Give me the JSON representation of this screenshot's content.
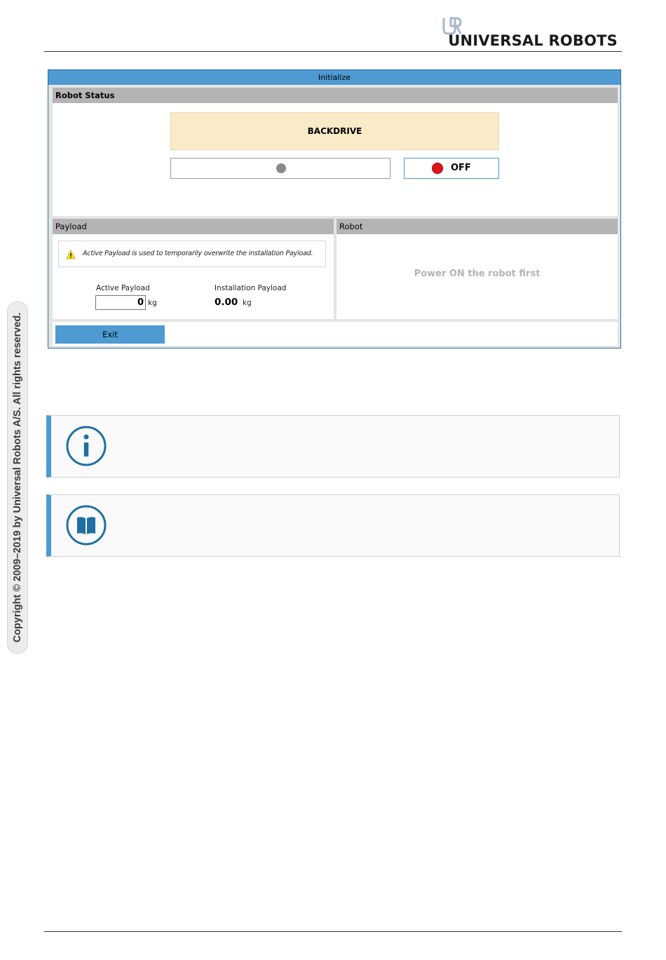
{
  "header": {
    "brand": "UNIVERSAL ROBOTS"
  },
  "sidebar": {
    "copyright": "Copyright © 2009–2019 by Universal Robots A/S. All rights reserved."
  },
  "dialog": {
    "title": "Initialize",
    "robot_status": {
      "header": "Robot Status",
      "state": "BACKDRIVE",
      "power_button_label": "OFF"
    },
    "payload": {
      "header": "Payload",
      "warning": "Active Payload is used to temporarily overwrite the installation Payload.",
      "active_label": "Active Payload",
      "active_value": "0",
      "active_unit": "kg",
      "installation_label": "Installation Payload",
      "installation_value": "0.00",
      "installation_unit": "kg"
    },
    "robot": {
      "header": "Robot",
      "message": "Power ON the robot first"
    },
    "exit_label": "Exit"
  },
  "notes": [
    {
      "icon": "info-icon"
    },
    {
      "icon": "book-icon"
    }
  ],
  "colors": {
    "accent": "#4d9bd2",
    "status_banner": "#faebc8",
    "off_indicator": "#e0141a",
    "icon_blue": "#1f6fa3"
  }
}
